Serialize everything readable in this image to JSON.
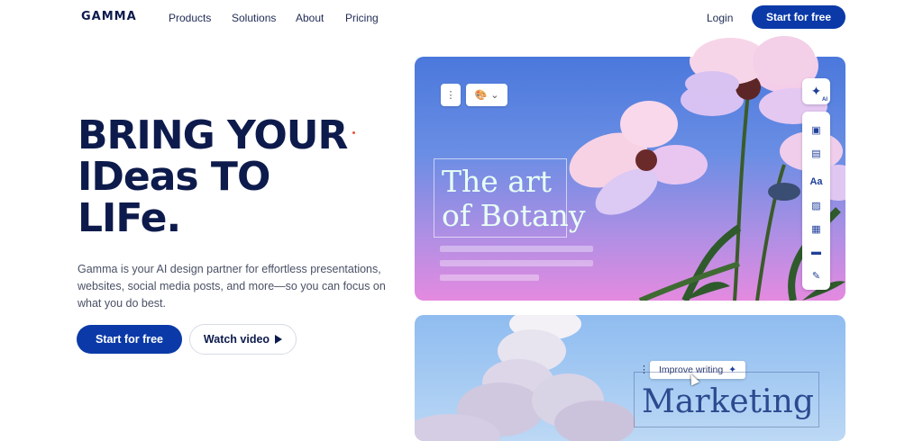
{
  "nav": {
    "logo": "GAMMA",
    "links": [
      "Products",
      "Solutions",
      "About",
      "Pricing"
    ],
    "login": "Login",
    "cta": "Start for free"
  },
  "hero": {
    "headline": [
      "BRING YOUR",
      "IDeas TO",
      "LIFe."
    ],
    "subtitle": "Gamma is your AI design partner for effortless presentations, websites, social media posts, and more—so you can focus on what you do best.",
    "primary_button": "Start for free",
    "secondary_button": "Watch video"
  },
  "card1": {
    "title_line1": "The art",
    "title_line2": "of Botany",
    "ai_badge": "AI",
    "side_tools": [
      "Aa"
    ]
  },
  "card2": {
    "improve_label": "Improve writing",
    "title": "Marketing"
  },
  "colors": {
    "brand": "#0b3aa8",
    "navy": "#0d1b4c",
    "accent_dot": "#e6553b"
  }
}
